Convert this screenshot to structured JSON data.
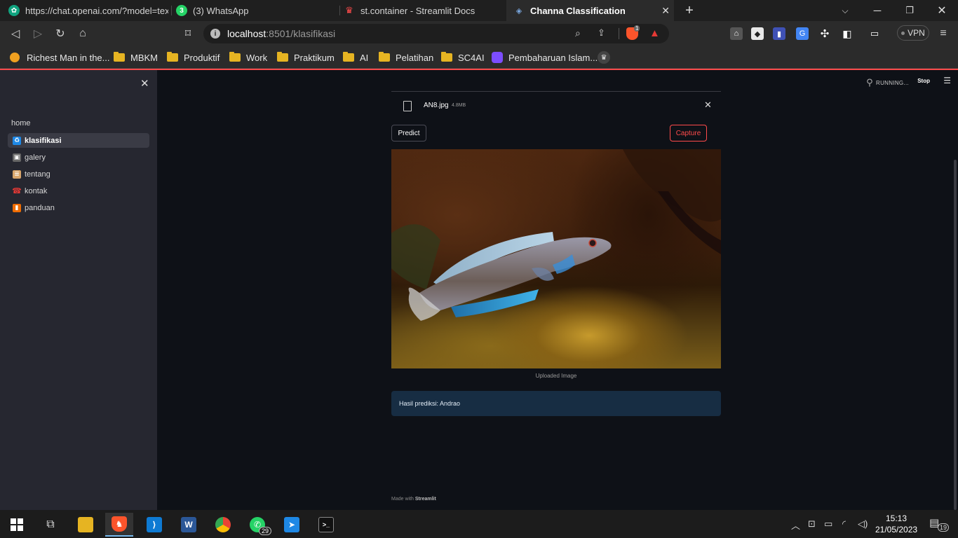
{
  "browser": {
    "tabs": [
      {
        "title": "https://chat.openai.com/?model=text-",
        "favicon": "chatgpt-icon",
        "color": "#10a37f"
      },
      {
        "title": "(3) WhatsApp",
        "favicon": "whatsapp-icon",
        "badge": "3",
        "color": "#25d366"
      },
      {
        "title": "st.container - Streamlit Docs",
        "favicon": "streamlit-icon",
        "color": "#ff4b4b"
      },
      {
        "title": "Channa Classification",
        "favicon": "fish-icon",
        "color": "#4a8fd8"
      }
    ],
    "url_host": "localhost",
    "url_rest": ":8501/klasifikasi",
    "brave_badge": "1",
    "vpn_label": "VPN",
    "bookmarks": [
      {
        "label": "Richest Man in the...",
        "type": "page"
      },
      {
        "label": "MBKM",
        "type": "folder"
      },
      {
        "label": "Produktif",
        "type": "folder"
      },
      {
        "label": "Work",
        "type": "folder"
      },
      {
        "label": "Praktikum",
        "type": "folder"
      },
      {
        "label": "AI",
        "type": "folder"
      },
      {
        "label": "Pelatihan",
        "type": "folder"
      },
      {
        "label": "SC4AI",
        "type": "folder"
      },
      {
        "label": "Pembaharuan Islam...",
        "type": "page"
      }
    ]
  },
  "sidebar": {
    "home_label": "home",
    "items": [
      {
        "label": "klasifikasi",
        "icon": "recycle-icon",
        "active": true
      },
      {
        "label": "galery",
        "icon": "camera-icon",
        "active": false
      },
      {
        "label": "tentang",
        "icon": "scroll-icon",
        "active": false
      },
      {
        "label": "kontak",
        "icon": "telephone-icon",
        "active": false
      },
      {
        "label": "panduan",
        "icon": "book-icon",
        "active": false
      }
    ]
  },
  "app": {
    "status": "RUNNING...",
    "stop_label": "Stop",
    "file_name": "AN8.jpg",
    "file_size": "4.8MB",
    "predict_label": "Predict",
    "capture_label": "Capture",
    "image_caption": "Uploaded Image",
    "result_text": "Hasil prediksi: Andrao",
    "footer_prefix": "Made with",
    "footer_brand": "Streamlit",
    "accent": "#ff4b4b"
  },
  "taskbar": {
    "apps": [
      {
        "name": "file-explorer-icon",
        "color": "#e6b422"
      },
      {
        "name": "brave-icon",
        "color": "#fb542b",
        "active": true
      },
      {
        "name": "vscode-icon",
        "color": "#0e7ad3"
      },
      {
        "name": "word-icon",
        "color": "#2b5797"
      },
      {
        "name": "chrome-icon",
        "color": "#4285f4"
      },
      {
        "name": "whatsapp-icon",
        "color": "#25d366",
        "badge": "29"
      },
      {
        "name": "remote-icon",
        "color": "#1e88e5"
      },
      {
        "name": "terminal-icon",
        "color": "#333333"
      }
    ],
    "time": "15:13",
    "date": "21/05/2023",
    "notif_count": "19"
  }
}
